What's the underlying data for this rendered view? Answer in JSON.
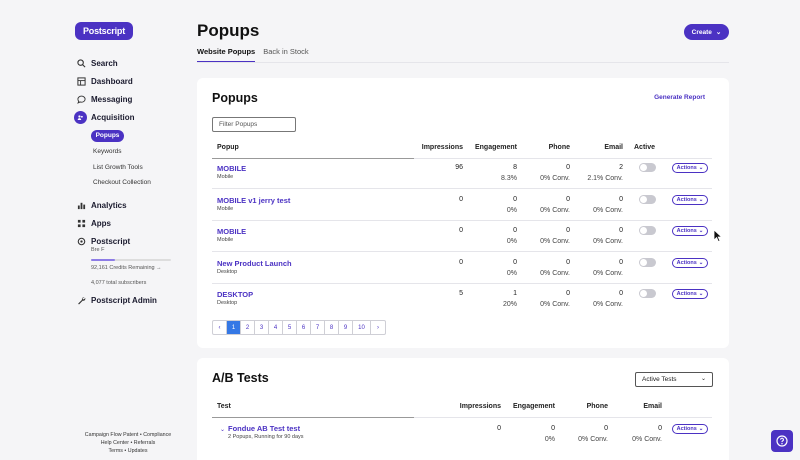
{
  "brand": {
    "logo_text": "Postscript",
    "accent": "#4b32c3"
  },
  "sidebar": {
    "items": [
      {
        "label": "Search",
        "icon": "search-icon"
      },
      {
        "label": "Dashboard",
        "icon": "dashboard-icon"
      },
      {
        "label": "Messaging",
        "icon": "chat-icon"
      },
      {
        "label": "Acquisition",
        "icon": "acquisition-icon"
      },
      {
        "label": "Analytics",
        "icon": "analytics-icon"
      },
      {
        "label": "Apps",
        "icon": "apps-icon"
      },
      {
        "label": "Postscript",
        "icon": "settings-icon"
      },
      {
        "label": "Postscript Admin",
        "icon": "wrench-icon"
      }
    ],
    "acquisition_sub": [
      "Popups",
      "Keywords",
      "List Growth Tools",
      "Checkout Collection"
    ],
    "shop_name": "Bre F",
    "credits": "92,161 Credits Remaining →",
    "credits_fraction": 0.3,
    "subscribers": "4,077 total subscribers",
    "footer": {
      "link1": "Campaign Flow Patent",
      "link2": "Compliance",
      "link3": "Help Center",
      "link4": "Referrals",
      "link5": "Terms",
      "link6": "Updates",
      "sep": "•"
    }
  },
  "page": {
    "title": "Popups",
    "create_label": "Create",
    "tabs": [
      "Website Popups",
      "Back in Stock"
    ]
  },
  "popups_card": {
    "title": "Popups",
    "generate_report": "Generate Report",
    "filter_placeholder": "Filter Popups",
    "columns": [
      "Popup",
      "Impressions",
      "Engagement",
      "Phone",
      "Email",
      "Active"
    ],
    "rows": [
      {
        "name": "MOBILE",
        "device": "Mobile",
        "impressions": "96",
        "engagement": "8",
        "engagement_pct": "8.3%",
        "phone": "0",
        "phone_conv": "0% Conv.",
        "email": "2",
        "email_conv": "2.1% Conv.",
        "actions": "Actions"
      },
      {
        "name": "MOBILE v1 jerry test",
        "device": "Mobile",
        "impressions": "0",
        "engagement": "0",
        "engagement_pct": "0%",
        "phone": "0",
        "phone_conv": "0% Conv.",
        "email": "0",
        "email_conv": "0% Conv.",
        "actions": "Actions"
      },
      {
        "name": "MOBILE",
        "device": "Mobile",
        "impressions": "0",
        "engagement": "0",
        "engagement_pct": "0%",
        "phone": "0",
        "phone_conv": "0% Conv.",
        "email": "0",
        "email_conv": "0% Conv.",
        "actions": "Actions"
      },
      {
        "name": "New Product Launch",
        "device": "Desktop",
        "impressions": "0",
        "engagement": "0",
        "engagement_pct": "0%",
        "phone": "0",
        "phone_conv": "0% Conv.",
        "email": "0",
        "email_conv": "0% Conv.",
        "actions": "Actions"
      },
      {
        "name": "DESKTOP",
        "device": "Desktop",
        "impressions": "5",
        "engagement": "1",
        "engagement_pct": "20%",
        "phone": "0",
        "phone_conv": "0% Conv.",
        "email": "0",
        "email_conv": "0% Conv.",
        "actions": "Actions"
      }
    ],
    "pagination": {
      "prev": "‹",
      "next": "›",
      "pages": [
        "1",
        "2",
        "3",
        "4",
        "5",
        "6",
        "7",
        "8",
        "9",
        "10"
      ],
      "current": "1"
    }
  },
  "ab_card": {
    "title": "A/B Tests",
    "select_value": "Active Tests",
    "columns": [
      "Test",
      "Impressions",
      "Engagement",
      "Phone",
      "Email"
    ],
    "rows": [
      {
        "name": "Fondue AB Test test",
        "meta": "2 Popups, Running for 90 days",
        "impressions": "0",
        "engagement": "0",
        "engagement_pct": "0%",
        "phone": "0",
        "phone_conv": "0% Conv.",
        "email": "0",
        "email_conv": "0% Conv.",
        "actions": "Actions"
      }
    ]
  }
}
